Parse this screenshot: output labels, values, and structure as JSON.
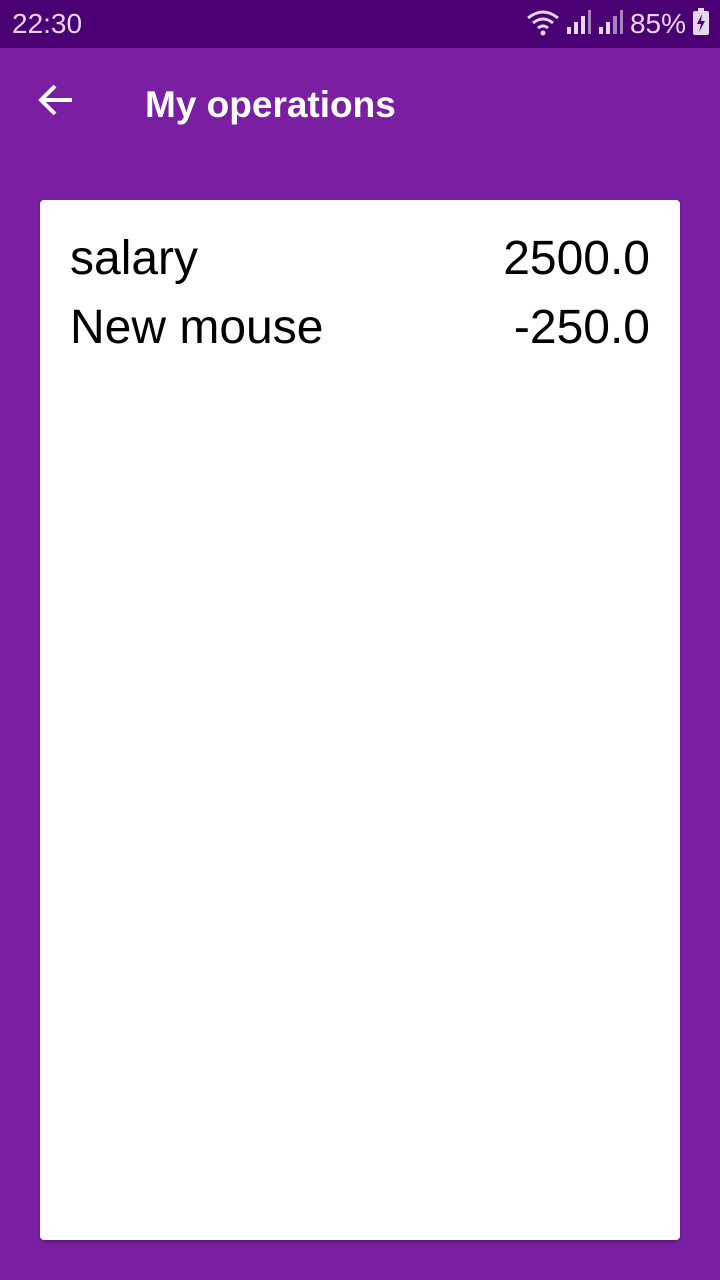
{
  "status_bar": {
    "time": "22:30",
    "battery": "85%",
    "icons": [
      "wifi-icon",
      "signal-icon",
      "signal-icon",
      "battery-charging-icon"
    ]
  },
  "app_bar": {
    "back_icon": "arrow-left-icon",
    "title": "My operations"
  },
  "operations": [
    {
      "name": "salary",
      "amount": "2500.0"
    },
    {
      "name": "New mouse",
      "amount": "-250.0"
    }
  ],
  "colors": {
    "status_bar": "#4a0072",
    "primary": "#7b1fa2",
    "card": "#ffffff",
    "text": "#000000"
  }
}
